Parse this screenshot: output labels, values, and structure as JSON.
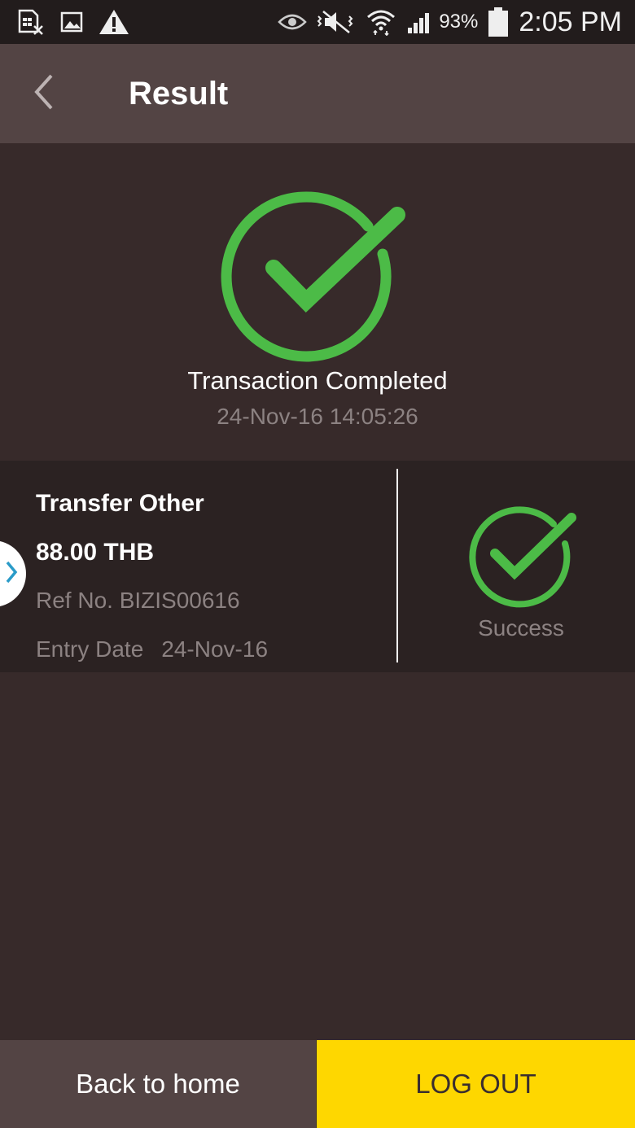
{
  "status_bar": {
    "left_icons": [
      "sim-card-blocked-icon",
      "image-icon",
      "warning-icon"
    ],
    "right_icons": [
      "eye-icon",
      "mute-vibrate-icon",
      "wifi-icon",
      "signal-icon",
      "battery-icon"
    ],
    "battery_percent": "93%",
    "time": "2:05 PM"
  },
  "app_bar": {
    "title": "Result",
    "back_icon": "chevron-left-icon"
  },
  "result": {
    "title": "Transaction Completed",
    "timestamp": "24-Nov-16 14:05:26",
    "icon": "check-circle-icon",
    "accent_color": "#4cbb47"
  },
  "transaction": {
    "type": "Transfer Other",
    "amount": "88.00 THB",
    "ref": "Ref No. BIZIS00616",
    "entry_label": "Entry Date",
    "entry_date": "24-Nov-16",
    "status": "Success",
    "status_icon": "check-circle-icon",
    "side_tab_icon": "chevron-right-icon"
  },
  "actions": {
    "back_home_label": "Back to home",
    "logout_label": "LOG OUT",
    "logout_color": "#fed700"
  }
}
